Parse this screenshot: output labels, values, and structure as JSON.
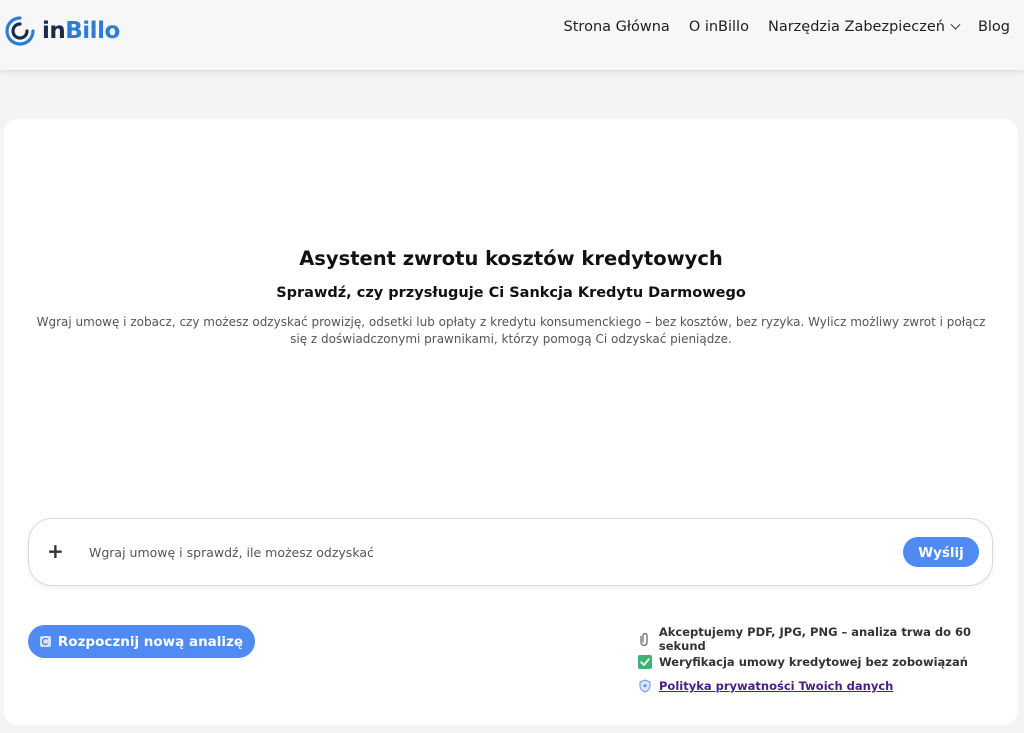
{
  "brand": {
    "logo_in": "in",
    "logo_billo": "Billo"
  },
  "nav": {
    "items": [
      {
        "label": "Strona Główna"
      },
      {
        "label": "O inBillo"
      },
      {
        "label": "Narzędzia Zabezpieczeń"
      },
      {
        "label": "Blog"
      }
    ]
  },
  "hero": {
    "title": "Asystent zwrotu kosztów kredytowych",
    "subtitle": "Sprawdź, czy przysługuje Ci Sankcja Kredytu Darmowego",
    "description": "Wgraj umowę i zobacz, czy możesz odzyskać prowizję, odsetki lub opłaty z kredytu konsumenckiego – bez kosztów, bez ryzyka. Wylicz możliwy zwrot i połącz się z doświadczonymi prawnikami, którzy pomogą Ci odzyskać pieniądze."
  },
  "chat": {
    "attach_icon": "+",
    "placeholder": "Wgraj umowę i sprawdź, ile możesz odzyskać",
    "value": "",
    "send_label": "Wyślij"
  },
  "actions": {
    "new_analysis_label": "Rozpocznij nową analizę"
  },
  "info": {
    "formats": "Akceptujemy PDF, JPG, PNG – analiza trwa do 60 sekund",
    "verification": "Weryfikacja umowy kredytowej bez zobowiązań",
    "privacy_link": "Polityka prywatności Twoich danych"
  },
  "colors": {
    "accent": "#4f8bf2",
    "brand_dark": "#1b2a4a",
    "brand_blue": "#2d7dd2",
    "link": "#4b1e83",
    "check_green": "#3cb371"
  }
}
